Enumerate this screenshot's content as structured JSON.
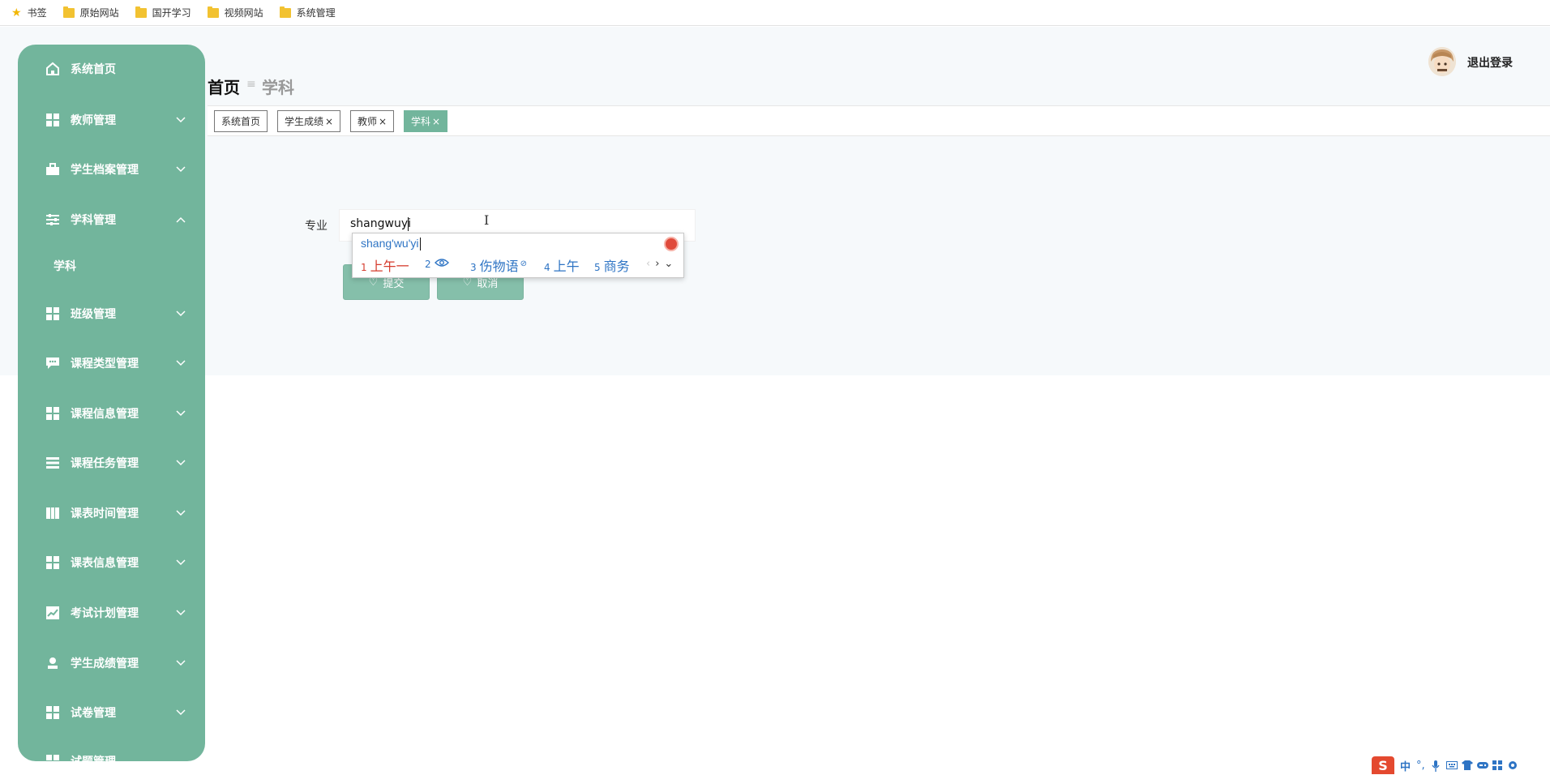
{
  "bookmarks": [
    {
      "label": "书签",
      "icon": "star-icon"
    },
    {
      "label": "原始网站",
      "icon": "folder-icon"
    },
    {
      "label": "国开学习",
      "icon": "folder-icon"
    },
    {
      "label": "视频网站",
      "icon": "folder-icon"
    },
    {
      "label": "系统管理",
      "icon": "folder-icon"
    }
  ],
  "sidebar": {
    "items": [
      {
        "label": "系统首页",
        "icon": "home-icon"
      },
      {
        "label": "教师管理",
        "icon": "grid-icon",
        "expanded": false
      },
      {
        "label": "学生档案管理",
        "icon": "briefcase-icon",
        "expanded": false
      },
      {
        "label": "学科管理",
        "icon": "sliders-icon",
        "expanded": true
      },
      {
        "label": "班级管理",
        "icon": "grid-icon",
        "expanded": false
      },
      {
        "label": "课程类型管理",
        "icon": "chat-icon",
        "expanded": false
      },
      {
        "label": "课程信息管理",
        "icon": "grid-icon",
        "expanded": false
      },
      {
        "label": "课程任务管理",
        "icon": "list-icon",
        "expanded": false
      },
      {
        "label": "课表时间管理",
        "icon": "book-icon",
        "expanded": false
      },
      {
        "label": "课表信息管理",
        "icon": "grid-icon",
        "expanded": false
      },
      {
        "label": "考试计划管理",
        "icon": "chart-icon",
        "expanded": false
      },
      {
        "label": "学生成绩管理",
        "icon": "user-icon",
        "expanded": false
      },
      {
        "label": "试卷管理",
        "icon": "grid-icon",
        "expanded": false
      },
      {
        "label": "试题管理",
        "icon": "grid-icon",
        "expanded": false
      }
    ],
    "submenu": {
      "label": "学科"
    }
  },
  "header": {
    "breadcrumb_home": "首页",
    "breadcrumb_sep": "≡",
    "breadcrumb_current": "学科",
    "logout_label": "退出登录"
  },
  "tabs": [
    {
      "label": "系统首页",
      "closable": false,
      "active": false
    },
    {
      "label": "学生成绩",
      "closable": true,
      "active": false
    },
    {
      "label": "教师",
      "closable": true,
      "active": false
    },
    {
      "label": "学科",
      "closable": true,
      "active": true
    }
  ],
  "tab_close_glyph": "×",
  "form": {
    "field_label": "专业",
    "field_value": "shangwuyi",
    "submit_label": "提交",
    "cancel_label": "取消"
  },
  "ime": {
    "pinyin": "shang'wu'yi",
    "candidates": [
      {
        "num": "1",
        "text": "上午一"
      },
      {
        "num": "2",
        "text": "",
        "icon": "eye-icon"
      },
      {
        "num": "3",
        "text": "伤物语",
        "icon": "check-circle-icon"
      },
      {
        "num": "4",
        "text": "上午"
      },
      {
        "num": "5",
        "text": "商务"
      }
    ]
  },
  "tray": {
    "ime_mode": "中",
    "punct": "°,"
  },
  "colors": {
    "accent": "#72b59c",
    "ime_blue": "#2e74c4",
    "ime_red": "#d63c2e",
    "sogou_red": "#e4492f"
  }
}
